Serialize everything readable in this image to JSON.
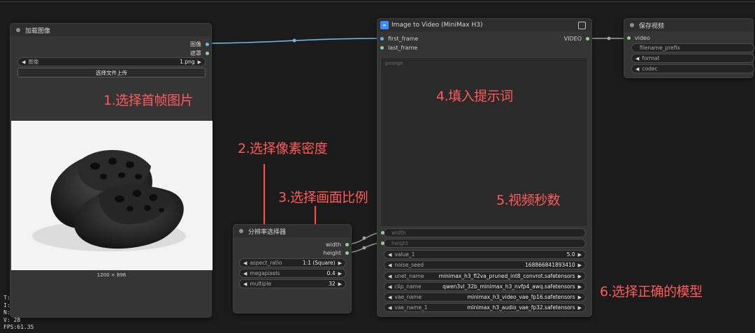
{
  "nodes": {
    "load_image": {
      "title": "加载图像",
      "outputs": [
        "图像",
        "遮罩"
      ],
      "image_widget": {
        "label": "图像",
        "value": "1.png"
      },
      "upload_button": "选择文件上传",
      "image_size": "1200 × 896"
    },
    "resolution": {
      "title": "分辨率选择器",
      "outputs": [
        "width",
        "height"
      ],
      "widgets": [
        {
          "label": "aspect_ratio",
          "value": "1:1 (Square)"
        },
        {
          "label": "megapixels",
          "value": "0.4"
        },
        {
          "label": "multiple",
          "value": "32"
        }
      ]
    },
    "i2v": {
      "title": "Image to Video (MiniMax H3)",
      "inputs": [
        "first_frame",
        "last_frame"
      ],
      "output": "VIDEO",
      "prompt_placeholder": "prompt",
      "linked_inputs": [
        "width",
        "height"
      ],
      "widgets": [
        {
          "label": "value_1",
          "value": "5.0"
        },
        {
          "label": "noise_seed",
          "value": "168866841893410"
        }
      ],
      "model_widgets": [
        {
          "label": "unet_name",
          "value": "minimax_h3_fl2va_pruned_int8_convrot.safetensors"
        },
        {
          "label": "clip_name",
          "value": "qwen3vl_32b_minimax_h3_nvfp4_awq.safetensors"
        },
        {
          "label": "vae_name",
          "value": "minimax_h3_video_vae_fp16.safetensors"
        },
        {
          "label": "vae_name_1",
          "value": "minimax_h3_audio_vae_fp32.safetensors"
        }
      ]
    },
    "save_video": {
      "title": "保存视频",
      "input": "video",
      "widgets": [
        "filename_prefix",
        "format",
        "codec"
      ]
    }
  },
  "annotations": {
    "a1": "1.选择首帧图片",
    "a2": "2.选择像素密度",
    "a3": "3.选择画面比例",
    "a4": "4.填入提示词",
    "a5": "5.视频秒数",
    "a6": "6.选择正确的模型"
  },
  "hud": [
    "T:",
    "I:",
    "N:",
    "V: 28",
    "FPS:61.35"
  ],
  "colors": {
    "accent_red": "#ff5a5a",
    "wire_blue": "#6db3e8",
    "pin_green": "#88d888",
    "node_bg": "#353535",
    "canvas_bg": "#1b1b1b"
  }
}
